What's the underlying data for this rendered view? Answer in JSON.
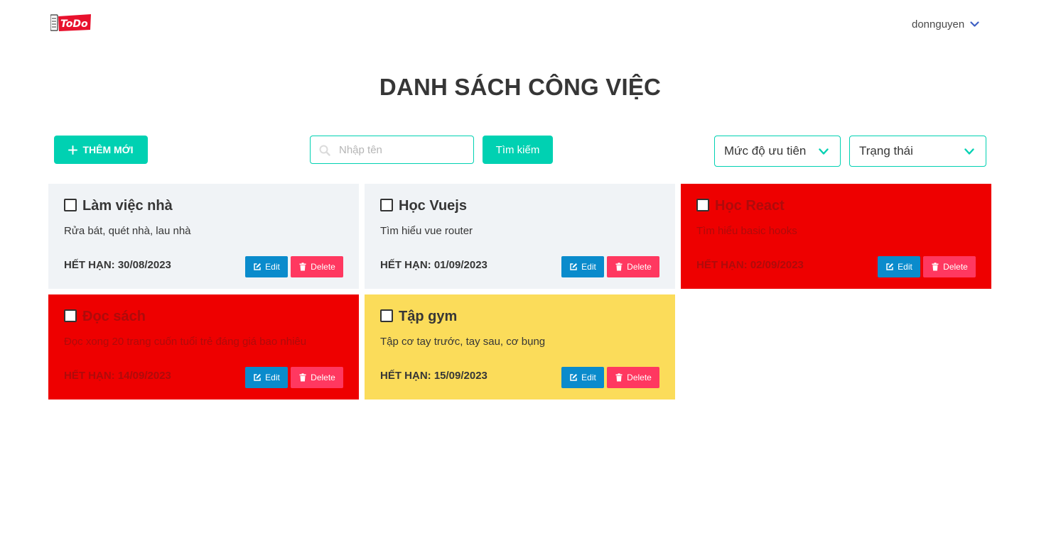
{
  "header": {
    "logo_text": "ToDo",
    "username": "donnguyen"
  },
  "page": {
    "title": "DANH SÁCH CÔNG VIỆC"
  },
  "toolbar": {
    "add_label": "THÊM MỚI",
    "search_placeholder": "Nhập tên",
    "search_value": "",
    "search_button": "Tìm kiếm",
    "priority_select": "Mức độ ưu tiên",
    "status_select": "Trạng thái"
  },
  "labels": {
    "edit": "Edit",
    "delete": "Delete"
  },
  "colors": {
    "primary": "#00d1b2",
    "edit": "#0a8bcc",
    "delete": "#ff3860",
    "card_gray": "#f0f3f6",
    "card_red": "#ee0000",
    "card_yellow": "#fbdc5a"
  },
  "tasks": [
    {
      "title": "Làm việc nhà",
      "description": "Rửa bát, quét nhà, lau nhà",
      "deadline": "HẾT HẠN: 30/08/2023",
      "color": "gray",
      "checked": false
    },
    {
      "title": "Học Vuejs",
      "description": "Tìm hiểu vue router",
      "deadline": "HẾT HẠN: 01/09/2023",
      "color": "gray",
      "checked": false
    },
    {
      "title": "Học React",
      "description": "Tìm hiểu basic hooks",
      "deadline": "HẾT HẠN: 02/09/2023",
      "color": "red",
      "checked": false
    },
    {
      "title": "Đọc sách",
      "description": "Đọc xong 20 trang cuốn tuổi trẻ đáng giá bao nhiêu",
      "deadline": "HẾT HẠN: 14/09/2023",
      "color": "red",
      "checked": false
    },
    {
      "title": "Tập gym",
      "description": "Tập cơ tay trước, tay sau, cơ bụng",
      "deadline": "HẾT HẠN: 15/09/2023",
      "color": "yellow",
      "checked": false
    }
  ]
}
